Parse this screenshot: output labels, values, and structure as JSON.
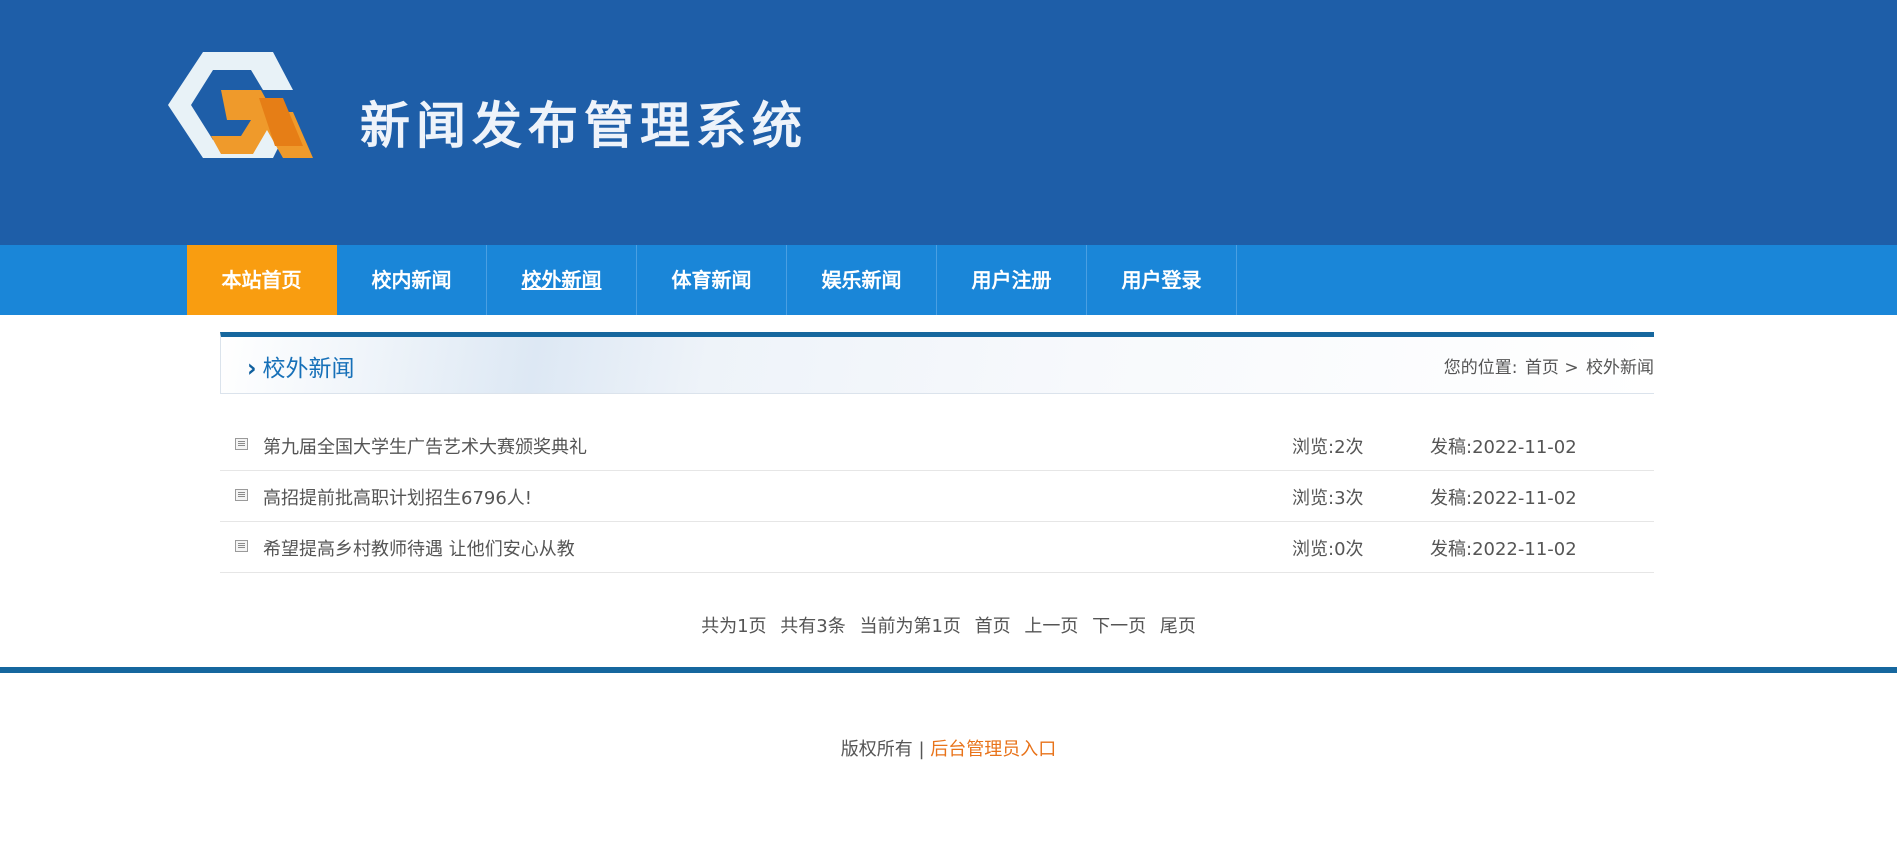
{
  "header": {
    "site_title": "新闻发布管理系统",
    "logo_icon": "logo-icon",
    "background": "#1e5ea8"
  },
  "nav": {
    "items": [
      {
        "label": "本站首页",
        "active": true
      },
      {
        "label": "校内新闻"
      },
      {
        "label": "校外新闻",
        "current": true
      },
      {
        "label": "体育新闻"
      },
      {
        "label": "娱乐新闻"
      },
      {
        "label": "用户注册"
      },
      {
        "label": "用户登录"
      }
    ],
    "active_color": "#f99d10",
    "bar_color": "#1a86d8"
  },
  "panel": {
    "title": "校外新闻",
    "breadcrumb_prefix": "您的位置:",
    "breadcrumb_home": "首页 >",
    "breadcrumb_current": "校外新闻"
  },
  "news": [
    {
      "title": "第九届全国大学生广告艺术大赛颁奖典礼",
      "views": "浏览:2次",
      "date": "发稿:2022-11-02"
    },
    {
      "title": "高招提前批高职计划招生6796人!",
      "views": "浏览:3次",
      "date": "发稿:2022-11-02"
    },
    {
      "title": "希望提高乡村教师待遇 让他们安心从教",
      "views": "浏览:0次",
      "date": "发稿:2022-11-02"
    }
  ],
  "pager": {
    "total_pages": "共为1页",
    "total_items": "共有3条",
    "current": "当前为第1页",
    "first": "首页",
    "prev": "上一页",
    "next": "下一页",
    "last": "尾页"
  },
  "footer": {
    "copyright": "版权所有 |",
    "admin_link": "后台管理员入口",
    "admin_color": "#e8731a"
  }
}
